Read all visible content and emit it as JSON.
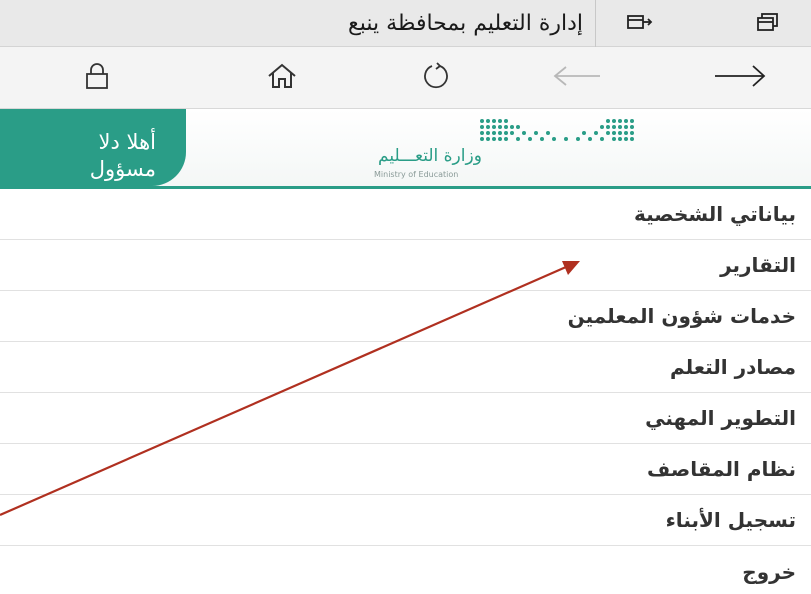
{
  "browser": {
    "tab_title": "إدارة التعليم بمحافظة ينبع",
    "icons": {
      "tab_switcher": "tabs-icon",
      "set_aside_tabs": "set-aside-tabs-icon",
      "reading": "lock-icon",
      "home": "home-icon",
      "refresh": "refresh-icon",
      "back": "arrow-left-icon",
      "forward": "arrow-right-icon"
    }
  },
  "header": {
    "greeting_line1": "أهلا دلا",
    "greeting_line2": "مسؤول",
    "logo_ar": "وزارة التعـــليم",
    "logo_en": "Ministry of Education",
    "brand_color": "#2a9d87"
  },
  "menu": {
    "items": [
      {
        "label": "بياناتي الشخصية"
      },
      {
        "label": "التقارير"
      },
      {
        "label": "خدمات شؤون المعلمين"
      },
      {
        "label": "مصادر التعلم"
      },
      {
        "label": "التطوير المهني"
      },
      {
        "label": "نظام المقاصف"
      },
      {
        "label": "تسجيل الأبناء"
      },
      {
        "label": "خروج"
      }
    ]
  },
  "annotation": {
    "color": "#b03020",
    "points_to": "التقارير"
  }
}
